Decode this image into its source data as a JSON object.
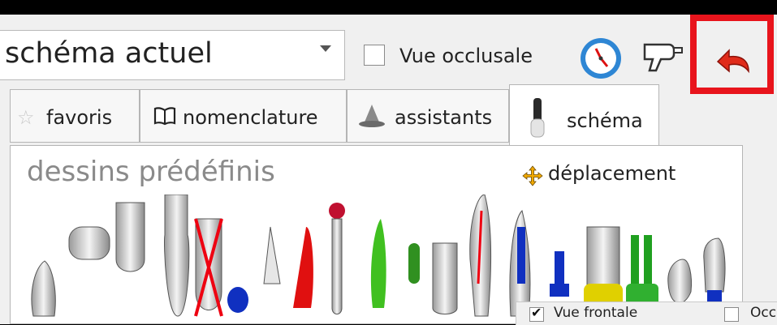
{
  "toolbar": {
    "scheme_select": {
      "value": "schéma actuel"
    },
    "occlusal_view": {
      "label": "Vue occlusale",
      "checked": false
    },
    "icons": [
      "clock-icon",
      "tooth-drill-icon",
      "undo-arrow-icon"
    ],
    "highlight_color": "#e8141c"
  },
  "tabs": [
    {
      "label": "favoris",
      "icon": "star-icon",
      "active": false
    },
    {
      "label": "nomenclature",
      "icon": "book-icon",
      "active": false
    },
    {
      "label": "assistants",
      "icon": "wizard-hat-icon",
      "active": false
    },
    {
      "label": "schéma",
      "icon": "tooth-tab-icon",
      "active": true
    }
  ],
  "panel": {
    "title": "dessins prédéfinis",
    "move_label": "déplacement"
  },
  "subpanel": {
    "frontal_view": {
      "label": "Vue frontale",
      "checked": true
    },
    "occlusal_truncated": {
      "label": "Occl",
      "checked": false
    }
  }
}
